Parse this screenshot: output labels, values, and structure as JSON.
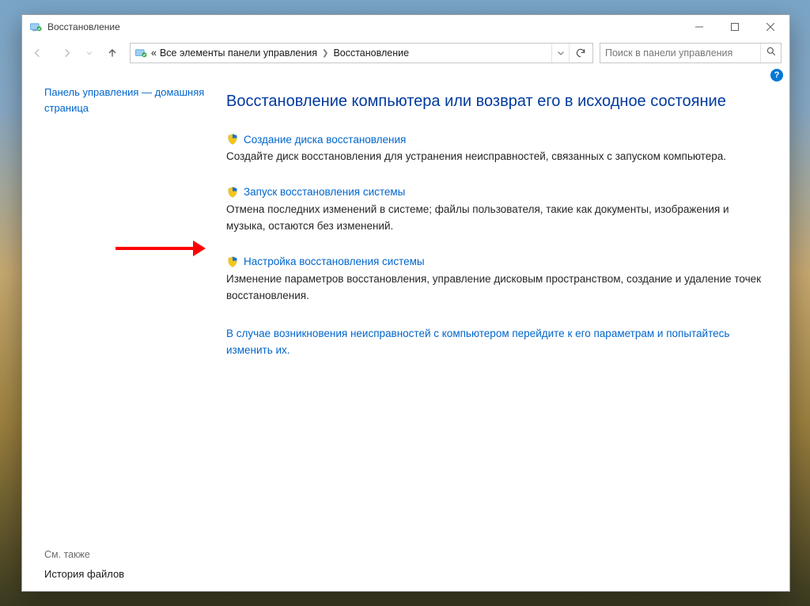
{
  "window": {
    "title": "Восстановление"
  },
  "breadcrumb": {
    "prefix": "«",
    "parent": "Все элементы панели управления",
    "current": "Восстановление"
  },
  "search": {
    "placeholder": "Поиск в панели управления"
  },
  "sidebar": {
    "home": "Панель управления — домашняя страница",
    "see_also_label": "См. также",
    "history_link": "История файлов"
  },
  "main": {
    "heading": "Восстановление компьютера или возврат его в исходное состояние",
    "options": [
      {
        "link": "Создание диска восстановления",
        "desc": "Создайте диск восстановления для устранения неисправностей, связанных с запуском компьютера."
      },
      {
        "link": "Запуск восстановления системы",
        "desc": "Отмена последних изменений в системе; файлы пользователя, такие как документы, изображения и музыка, остаются без изменений."
      },
      {
        "link": "Настройка восстановления системы",
        "desc": "Изменение параметров восстановления, управление дисковым пространством, создание и удаление точек восстановления."
      }
    ],
    "troubleshoot": "В случае возникновения неисправностей с компьютером перейдите к его параметрам и попытайтесь изменить их."
  }
}
